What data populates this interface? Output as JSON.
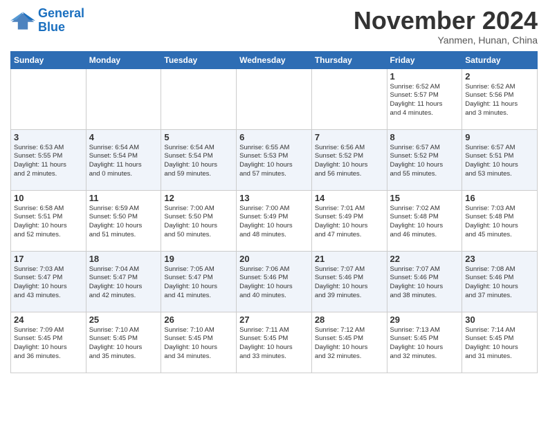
{
  "header": {
    "logo_line1": "General",
    "logo_line2": "Blue",
    "month_title": "November 2024",
    "location": "Yanmen, Hunan, China"
  },
  "weekdays": [
    "Sunday",
    "Monday",
    "Tuesday",
    "Wednesday",
    "Thursday",
    "Friday",
    "Saturday"
  ],
  "weeks": [
    [
      {
        "day": "",
        "info": ""
      },
      {
        "day": "",
        "info": ""
      },
      {
        "day": "",
        "info": ""
      },
      {
        "day": "",
        "info": ""
      },
      {
        "day": "",
        "info": ""
      },
      {
        "day": "1",
        "info": "Sunrise: 6:52 AM\nSunset: 5:57 PM\nDaylight: 11 hours\nand 4 minutes."
      },
      {
        "day": "2",
        "info": "Sunrise: 6:52 AM\nSunset: 5:56 PM\nDaylight: 11 hours\nand 3 minutes."
      }
    ],
    [
      {
        "day": "3",
        "info": "Sunrise: 6:53 AM\nSunset: 5:55 PM\nDaylight: 11 hours\nand 2 minutes."
      },
      {
        "day": "4",
        "info": "Sunrise: 6:54 AM\nSunset: 5:54 PM\nDaylight: 11 hours\nand 0 minutes."
      },
      {
        "day": "5",
        "info": "Sunrise: 6:54 AM\nSunset: 5:54 PM\nDaylight: 10 hours\nand 59 minutes."
      },
      {
        "day": "6",
        "info": "Sunrise: 6:55 AM\nSunset: 5:53 PM\nDaylight: 10 hours\nand 57 minutes."
      },
      {
        "day": "7",
        "info": "Sunrise: 6:56 AM\nSunset: 5:52 PM\nDaylight: 10 hours\nand 56 minutes."
      },
      {
        "day": "8",
        "info": "Sunrise: 6:57 AM\nSunset: 5:52 PM\nDaylight: 10 hours\nand 55 minutes."
      },
      {
        "day": "9",
        "info": "Sunrise: 6:57 AM\nSunset: 5:51 PM\nDaylight: 10 hours\nand 53 minutes."
      }
    ],
    [
      {
        "day": "10",
        "info": "Sunrise: 6:58 AM\nSunset: 5:51 PM\nDaylight: 10 hours\nand 52 minutes."
      },
      {
        "day": "11",
        "info": "Sunrise: 6:59 AM\nSunset: 5:50 PM\nDaylight: 10 hours\nand 51 minutes."
      },
      {
        "day": "12",
        "info": "Sunrise: 7:00 AM\nSunset: 5:50 PM\nDaylight: 10 hours\nand 50 minutes."
      },
      {
        "day": "13",
        "info": "Sunrise: 7:00 AM\nSunset: 5:49 PM\nDaylight: 10 hours\nand 48 minutes."
      },
      {
        "day": "14",
        "info": "Sunrise: 7:01 AM\nSunset: 5:49 PM\nDaylight: 10 hours\nand 47 minutes."
      },
      {
        "day": "15",
        "info": "Sunrise: 7:02 AM\nSunset: 5:48 PM\nDaylight: 10 hours\nand 46 minutes."
      },
      {
        "day": "16",
        "info": "Sunrise: 7:03 AM\nSunset: 5:48 PM\nDaylight: 10 hours\nand 45 minutes."
      }
    ],
    [
      {
        "day": "17",
        "info": "Sunrise: 7:03 AM\nSunset: 5:47 PM\nDaylight: 10 hours\nand 43 minutes."
      },
      {
        "day": "18",
        "info": "Sunrise: 7:04 AM\nSunset: 5:47 PM\nDaylight: 10 hours\nand 42 minutes."
      },
      {
        "day": "19",
        "info": "Sunrise: 7:05 AM\nSunset: 5:47 PM\nDaylight: 10 hours\nand 41 minutes."
      },
      {
        "day": "20",
        "info": "Sunrise: 7:06 AM\nSunset: 5:46 PM\nDaylight: 10 hours\nand 40 minutes."
      },
      {
        "day": "21",
        "info": "Sunrise: 7:07 AM\nSunset: 5:46 PM\nDaylight: 10 hours\nand 39 minutes."
      },
      {
        "day": "22",
        "info": "Sunrise: 7:07 AM\nSunset: 5:46 PM\nDaylight: 10 hours\nand 38 minutes."
      },
      {
        "day": "23",
        "info": "Sunrise: 7:08 AM\nSunset: 5:46 PM\nDaylight: 10 hours\nand 37 minutes."
      }
    ],
    [
      {
        "day": "24",
        "info": "Sunrise: 7:09 AM\nSunset: 5:45 PM\nDaylight: 10 hours\nand 36 minutes."
      },
      {
        "day": "25",
        "info": "Sunrise: 7:10 AM\nSunset: 5:45 PM\nDaylight: 10 hours\nand 35 minutes."
      },
      {
        "day": "26",
        "info": "Sunrise: 7:10 AM\nSunset: 5:45 PM\nDaylight: 10 hours\nand 34 minutes."
      },
      {
        "day": "27",
        "info": "Sunrise: 7:11 AM\nSunset: 5:45 PM\nDaylight: 10 hours\nand 33 minutes."
      },
      {
        "day": "28",
        "info": "Sunrise: 7:12 AM\nSunset: 5:45 PM\nDaylight: 10 hours\nand 32 minutes."
      },
      {
        "day": "29",
        "info": "Sunrise: 7:13 AM\nSunset: 5:45 PM\nDaylight: 10 hours\nand 32 minutes."
      },
      {
        "day": "30",
        "info": "Sunrise: 7:14 AM\nSunset: 5:45 PM\nDaylight: 10 hours\nand 31 minutes."
      }
    ]
  ]
}
